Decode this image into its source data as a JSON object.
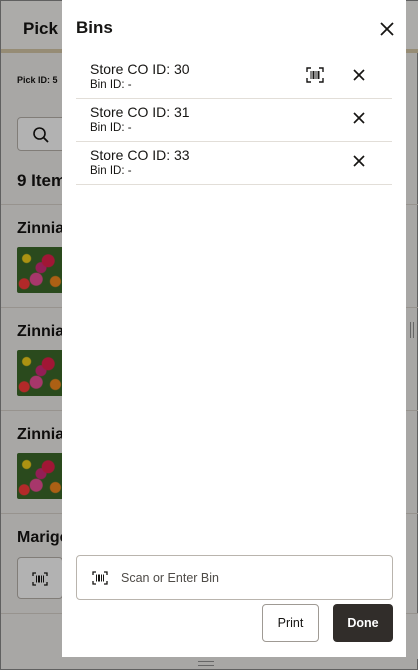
{
  "background_page": {
    "title": "Pick",
    "pick_id_label": "Pick ID: 5",
    "items_count": "9 Item",
    "items": [
      {
        "title": "Zinnia"
      },
      {
        "title": "Zinnia"
      },
      {
        "title": "Zinnia"
      },
      {
        "title": "Marige"
      }
    ]
  },
  "drawer": {
    "title": "Bins",
    "bins": [
      {
        "name": "Store CO ID: 30",
        "bin_id": "Bin ID: -",
        "has_scan_icon": true
      },
      {
        "name": "Store CO ID: 31",
        "bin_id": "Bin ID: -",
        "has_scan_icon": false
      },
      {
        "name": "Store CO ID: 33",
        "bin_id": "Bin ID: -",
        "has_scan_icon": false
      }
    ],
    "scan_input": {
      "placeholder": "Scan or Enter Bin",
      "value": ""
    },
    "print_label": "Print",
    "done_label": "Done"
  },
  "icons": {
    "close": "close-icon",
    "barcode": "barcode-scan-icon",
    "search": "search-icon"
  },
  "colors": {
    "done_button": "#312d2a",
    "scrim": "rgba(0,0,0,0.30)"
  }
}
